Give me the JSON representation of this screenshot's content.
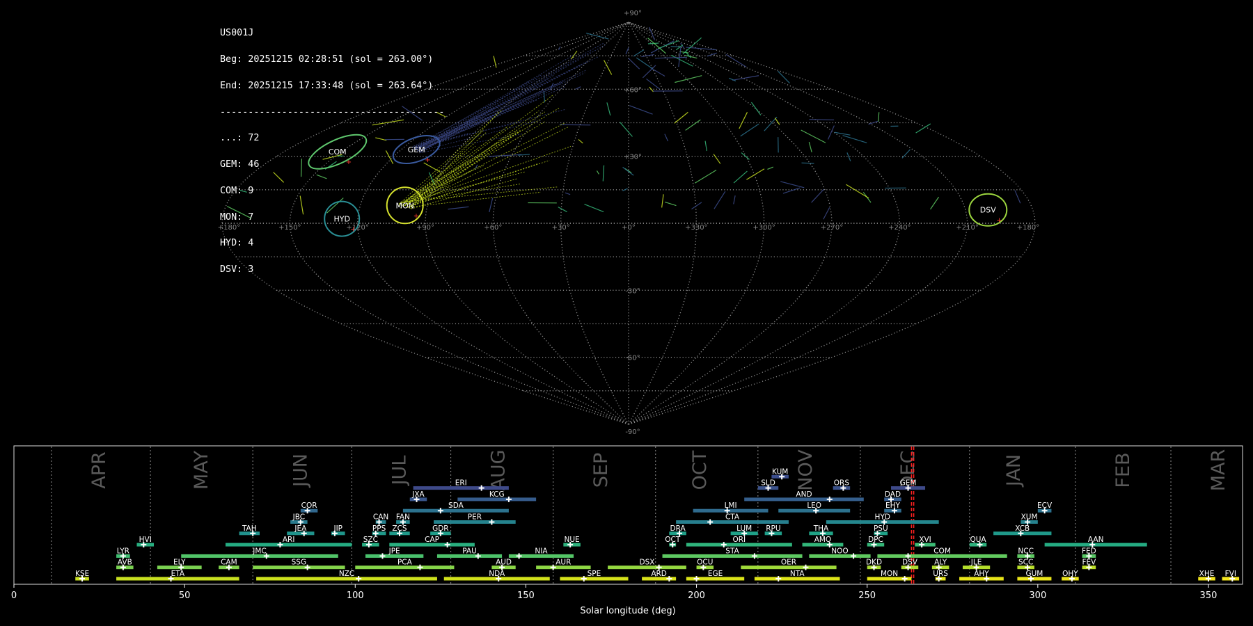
{
  "stats": {
    "station": "US001J",
    "begin": "Beg: 20251215 02:28:51 (sol = 263.00°)",
    "end": "End: 20251215 17:33:48 (sol = 263.64°)",
    "separator": "----------------------------------------",
    "counts": [
      "...: 72",
      "GEM: 46",
      "COM: 9",
      "MON: 7",
      "HYD: 4",
      "DSV: 3"
    ]
  },
  "sky_map": {
    "lon_labels": [
      "+180°",
      "+150°",
      "+120°",
      "+90°",
      "+60°",
      "+30°",
      "+0°",
      "+330°",
      "+300°",
      "+270°",
      "+240°",
      "+210°",
      "+180°"
    ],
    "lon_values": [
      180,
      150,
      120,
      90,
      60,
      30,
      0,
      330,
      300,
      270,
      240,
      210,
      180
    ],
    "lat_labels": [
      "+90°",
      "+60°",
      "+30°",
      "-30°",
      "-60°",
      "-90°"
    ],
    "lat_values": [
      90,
      60,
      30,
      -30,
      -60,
      -90
    ],
    "radiant_colors": {
      "COM": "#5fc86e",
      "GEM": "#3a5ba0",
      "MON": "#d6e22e",
      "HYD": "#2a8f95",
      "DSV": "#9bd43e"
    },
    "radiants": [
      {
        "code": "COM",
        "lon": 152,
        "lat": 32
      },
      {
        "code": "GEM",
        "lon": 112,
        "lat": 33
      },
      {
        "code": "MON",
        "lon": 100,
        "lat": 8
      },
      {
        "code": "HYD",
        "lon": 127,
        "lat": 2
      },
      {
        "code": "DSV",
        "lon": 200,
        "lat": 6
      }
    ]
  },
  "timeline": {
    "xlabel": "Solar longitude (deg)",
    "xticks": [
      0,
      50,
      100,
      150,
      200,
      250,
      300,
      350
    ],
    "months": [
      {
        "name": "APR",
        "sol": 25
      },
      {
        "name": "MAY",
        "sol": 55
      },
      {
        "name": "JUN",
        "sol": 84
      },
      {
        "name": "JUL",
        "sol": 113
      },
      {
        "name": "AUG",
        "sol": 142
      },
      {
        "name": "SEP",
        "sol": 172
      },
      {
        "name": "OCT",
        "sol": 201
      },
      {
        "name": "NOV",
        "sol": 232
      },
      {
        "name": "DEC",
        "sol": 262
      },
      {
        "name": "JAN",
        "sol": 293
      },
      {
        "name": "FEB",
        "sol": 325
      },
      {
        "name": "MAR",
        "sol": 353
      }
    ],
    "month_bounds": [
      11,
      40,
      70,
      99,
      128,
      158,
      188,
      218,
      248,
      280,
      311,
      339
    ],
    "observation_sol": [
      263.0,
      263.64
    ]
  },
  "chart_data": [
    {
      "type": "scatter",
      "title": "",
      "projection": "sinusoidal",
      "xlabel": "",
      "ylabel": "",
      "grid": true,
      "series": [
        {
          "name": "COM",
          "points": [
            {
              "x": 152,
              "y": 32
            }
          ],
          "count": 9
        },
        {
          "name": "GEM",
          "points": [
            {
              "x": 112,
              "y": 33
            }
          ],
          "count": 46
        },
        {
          "name": "MON",
          "points": [
            {
              "x": 100,
              "y": 8
            }
          ],
          "count": 7
        },
        {
          "name": "HYD",
          "points": [
            {
              "x": 127,
              "y": 2
            }
          ],
          "count": 4
        },
        {
          "name": "DSV",
          "points": [
            {
              "x": 200,
              "y": 6
            }
          ],
          "count": 3
        }
      ]
    },
    {
      "type": "bar",
      "title": "",
      "xlabel": "Solar longitude (deg)",
      "xlim": [
        0,
        360
      ],
      "grid": false,
      "showers": [
        {
          "code": "KUM",
          "start": 222,
          "end": 227,
          "peak": 225,
          "row": 8,
          "color": "#3b4d8c"
        },
        {
          "code": "ERI",
          "start": 117,
          "end": 145,
          "peak": 137,
          "row": 7,
          "color": "#3e4a89"
        },
        {
          "code": "SLD",
          "start": 218,
          "end": 224,
          "peak": 221,
          "row": 7,
          "color": "#3b528b"
        },
        {
          "code": "ORS",
          "start": 240,
          "end": 245,
          "peak": 243,
          "row": 7,
          "color": "#3b528b"
        },
        {
          "code": "GEM",
          "start": 257,
          "end": 267,
          "peak": 262,
          "row": 7,
          "color": "#3e4a89"
        },
        {
          "code": "JXA",
          "start": 116,
          "end": 121,
          "peak": 118,
          "row": 6,
          "color": "#39568c"
        },
        {
          "code": "KCG",
          "start": 130,
          "end": 153,
          "peak": 145,
          "row": 6,
          "color": "#365c8d"
        },
        {
          "code": "AND",
          "start": 214,
          "end": 249,
          "peak": 239,
          "row": 6,
          "color": "#355f8d"
        },
        {
          "code": "DAD",
          "start": 255,
          "end": 260,
          "peak": 257,
          "row": 6,
          "color": "#365c8d"
        },
        {
          "code": "COR",
          "start": 84,
          "end": 89,
          "peak": 86,
          "row": 5,
          "color": "#31688e"
        },
        {
          "code": "SDA",
          "start": 114,
          "end": 145,
          "peak": 125,
          "row": 5,
          "color": "#2c728e"
        },
        {
          "code": "LMI",
          "start": 199,
          "end": 221,
          "peak": 209,
          "row": 5,
          "color": "#2f6b8e"
        },
        {
          "code": "LEO",
          "start": 224,
          "end": 245,
          "peak": 235,
          "row": 5,
          "color": "#2c728e"
        },
        {
          "code": "EHY",
          "start": 255,
          "end": 260,
          "peak": 258,
          "row": 5,
          "color": "#2f6b8e"
        },
        {
          "code": "ECV",
          "start": 300,
          "end": 304,
          "peak": 302,
          "row": 5,
          "color": "#2c728e"
        },
        {
          "code": "JBC",
          "start": 81,
          "end": 86,
          "peak": 84,
          "row": 4,
          "color": "#297b8e"
        },
        {
          "code": "CAN",
          "start": 106,
          "end": 109,
          "peak": 107,
          "row": 4,
          "color": "#26818e"
        },
        {
          "code": "FAN",
          "start": 112,
          "end": 116,
          "peak": 114,
          "row": 4,
          "color": "#24868e"
        },
        {
          "code": "PER",
          "start": 123,
          "end": 147,
          "peak": 140,
          "row": 4,
          "color": "#25838e"
        },
        {
          "code": "CTA",
          "start": 194,
          "end": 227,
          "peak": 204,
          "row": 4,
          "color": "#277f8e"
        },
        {
          "code": "HYD",
          "start": 238,
          "end": 271,
          "peak": 255,
          "row": 4,
          "color": "#24878e"
        },
        {
          "code": "XUM",
          "start": 295,
          "end": 300,
          "peak": 297,
          "row": 4,
          "color": "#26828e"
        },
        {
          "code": "TAH",
          "start": 66,
          "end": 72,
          "peak": 70,
          "row": 3,
          "color": "#21918c"
        },
        {
          "code": "JEA",
          "start": 80,
          "end": 88,
          "peak": 85,
          "row": 3,
          "color": "#20938c"
        },
        {
          "code": "JIP",
          "start": 93,
          "end": 97,
          "peak": 94,
          "row": 3,
          "color": "#1f968b"
        },
        {
          "code": "PPS",
          "start": 105,
          "end": 109,
          "peak": 106,
          "row": 3,
          "color": "#1f998a"
        },
        {
          "code": "ZCS",
          "start": 110,
          "end": 116,
          "peak": 113,
          "row": 3,
          "color": "#1f9a8a"
        },
        {
          "code": "GDR",
          "start": 122,
          "end": 128,
          "peak": 125,
          "row": 3,
          "color": "#1f9e89"
        },
        {
          "code": "DRA",
          "start": 192,
          "end": 197,
          "peak": 195,
          "row": 3,
          "color": "#1fa088"
        },
        {
          "code": "LUM",
          "start": 210,
          "end": 218,
          "peak": 214,
          "row": 3,
          "color": "#1fa188"
        },
        {
          "code": "RPU",
          "start": 220,
          "end": 225,
          "peak": 222,
          "row": 3,
          "color": "#1f9e89"
        },
        {
          "code": "THA",
          "start": 233,
          "end": 240,
          "peak": 237,
          "row": 3,
          "color": "#20a386"
        },
        {
          "code": "PSU",
          "start": 252,
          "end": 256,
          "peak": 253,
          "row": 3,
          "color": "#1fa187"
        },
        {
          "code": "XCB",
          "start": 287,
          "end": 304,
          "peak": 295,
          "row": 3,
          "color": "#1f998a"
        },
        {
          "code": "HVI",
          "start": 36,
          "end": 41,
          "peak": 38,
          "row": 2,
          "color": "#28ae80"
        },
        {
          "code": "ARI",
          "start": 62,
          "end": 99,
          "peak": 78,
          "row": 2,
          "color": "#25ab82"
        },
        {
          "code": "SZC",
          "start": 102,
          "end": 107,
          "peak": 104,
          "row": 2,
          "color": "#27ad81"
        },
        {
          "code": "CAP",
          "start": 110,
          "end": 135,
          "peak": 127,
          "row": 2,
          "color": "#29af7f"
        },
        {
          "code": "NUE",
          "start": 161,
          "end": 166,
          "peak": 163,
          "row": 2,
          "color": "#2db27d"
        },
        {
          "code": "OCT",
          "start": 192,
          "end": 194,
          "peak": 193,
          "row": 2,
          "color": "#2eb37c"
        },
        {
          "code": "ORI",
          "start": 197,
          "end": 228,
          "peak": 208,
          "row": 2,
          "color": "#2fb47c"
        },
        {
          "code": "AMO",
          "start": 231,
          "end": 243,
          "peak": 239,
          "row": 2,
          "color": "#32b67a"
        },
        {
          "code": "DPC",
          "start": 250,
          "end": 255,
          "peak": 252,
          "row": 2,
          "color": "#35b779"
        },
        {
          "code": "XVI",
          "start": 264,
          "end": 270,
          "peak": 266,
          "row": 2,
          "color": "#3bbb75"
        },
        {
          "code": "QUA",
          "start": 280,
          "end": 285,
          "peak": 283,
          "row": 2,
          "color": "#2db27d"
        },
        {
          "code": "AAN",
          "start": 302,
          "end": 332,
          "peak": 316,
          "row": 2,
          "color": "#25ab82"
        },
        {
          "code": "LYR",
          "start": 30,
          "end": 34,
          "peak": 32,
          "row": 1,
          "color": "#40bd72"
        },
        {
          "code": "JMC",
          "start": 49,
          "end": 95,
          "peak": 74,
          "row": 1,
          "color": "#52c569"
        },
        {
          "code": "JPE",
          "start": 103,
          "end": 120,
          "peak": 108,
          "row": 1,
          "color": "#4ac16d"
        },
        {
          "code": "PAU",
          "start": 124,
          "end": 143,
          "peak": 136,
          "row": 1,
          "color": "#4ec36b"
        },
        {
          "code": "NIA",
          "start": 145,
          "end": 164,
          "peak": 148,
          "row": 1,
          "color": "#55c667"
        },
        {
          "code": "STA",
          "start": 190,
          "end": 231,
          "peak": 217,
          "row": 1,
          "color": "#5ec962"
        },
        {
          "code": "NOO",
          "start": 233,
          "end": 251,
          "peak": 246,
          "row": 1,
          "color": "#60ca60"
        },
        {
          "code": "COM",
          "start": 253,
          "end": 291,
          "peak": 262,
          "row": 1,
          "color": "#63cb5f"
        },
        {
          "code": "NCC",
          "start": 294,
          "end": 299,
          "peak": 297,
          "row": 1,
          "color": "#5ec962"
        },
        {
          "code": "FED",
          "start": 313,
          "end": 317,
          "peak": 315,
          "row": 1,
          "color": "#58c765"
        },
        {
          "code": "AVB",
          "start": 30,
          "end": 35,
          "peak": 32,
          "row": 0,
          "color": "#7ad151"
        },
        {
          "code": "ELY",
          "start": 42,
          "end": 55,
          "peak": 49,
          "row": 0,
          "color": "#7ad151"
        },
        {
          "code": "CAM",
          "start": 60,
          "end": 66,
          "peak": 63,
          "row": 0,
          "color": "#81d34d"
        },
        {
          "code": "SSG",
          "start": 70,
          "end": 97,
          "peak": 86,
          "row": 0,
          "color": "#84d44b"
        },
        {
          "code": "PCA",
          "start": 100,
          "end": 129,
          "peak": 119,
          "row": 0,
          "color": "#86d549"
        },
        {
          "code": "AUD",
          "start": 140,
          "end": 147,
          "peak": 143,
          "row": 0,
          "color": "#8bd646"
        },
        {
          "code": "AUR",
          "start": 153,
          "end": 169,
          "peak": 158,
          "row": 0,
          "color": "#8fd744"
        },
        {
          "code": "DSX",
          "start": 174,
          "end": 197,
          "peak": 189,
          "row": 0,
          "color": "#95d840"
        },
        {
          "code": "OCU",
          "start": 200,
          "end": 205,
          "peak": 202,
          "row": 0,
          "color": "#99d83d"
        },
        {
          "code": "OER",
          "start": 213,
          "end": 241,
          "peak": 232,
          "row": 0,
          "color": "#a0da39"
        },
        {
          "code": "DKD",
          "start": 250,
          "end": 254,
          "peak": 252,
          "row": 0,
          "color": "#a8db34"
        },
        {
          "code": "DSV",
          "start": 260,
          "end": 265,
          "peak": 262,
          "row": 0,
          "color": "#addc30"
        },
        {
          "code": "ALY",
          "start": 269,
          "end": 274,
          "peak": 271,
          "row": 0,
          "color": "#b2dd2d"
        },
        {
          "code": "JLE",
          "start": 278,
          "end": 286,
          "peak": 282,
          "row": 0,
          "color": "#b5de2b"
        },
        {
          "code": "SCC",
          "start": 294,
          "end": 299,
          "peak": 297,
          "row": 0,
          "color": "#b8de29"
        },
        {
          "code": "FEV",
          "start": 313,
          "end": 317,
          "peak": 315,
          "row": 0,
          "color": "#bddf26"
        },
        {
          "code": "KSE",
          "start": 18,
          "end": 22,
          "peak": 20,
          "row": -1,
          "color": "#c8e020"
        },
        {
          "code": "ETA",
          "start": 30,
          "end": 66,
          "peak": 46,
          "row": -1,
          "color": "#c8e020"
        },
        {
          "code": "NZC",
          "start": 71,
          "end": 124,
          "peak": 101,
          "row": -1,
          "color": "#cde11d"
        },
        {
          "code": "NDA",
          "start": 126,
          "end": 157,
          "peak": 142,
          "row": -1,
          "color": "#d2e21b"
        },
        {
          "code": "SPE",
          "start": 160,
          "end": 180,
          "peak": 167,
          "row": -1,
          "color": "#d5e21a"
        },
        {
          "code": "ARD",
          "start": 184,
          "end": 194,
          "peak": 192,
          "row": -1,
          "color": "#d8e219"
        },
        {
          "code": "EGE",
          "start": 197,
          "end": 214,
          "peak": 200,
          "row": -1,
          "color": "#dae319"
        },
        {
          "code": "NTA",
          "start": 217,
          "end": 242,
          "peak": 224,
          "row": -1,
          "color": "#dde318"
        },
        {
          "code": "MON",
          "start": 250,
          "end": 263,
          "peak": 261,
          "row": -1,
          "color": "#e2e418"
        },
        {
          "code": "URS",
          "start": 270,
          "end": 273,
          "peak": 271,
          "row": -1,
          "color": "#e5e419"
        },
        {
          "code": "AHY",
          "start": 277,
          "end": 290,
          "peak": 285,
          "row": -1,
          "color": "#e7e419"
        },
        {
          "code": "GUM",
          "start": 294,
          "end": 304,
          "peak": 298,
          "row": -1,
          "color": "#eae51a"
        },
        {
          "code": "OHY",
          "start": 307,
          "end": 312,
          "peak": 310,
          "row": -1,
          "color": "#ece51b"
        },
        {
          "code": "XHE",
          "start": 347,
          "end": 352,
          "peak": 350,
          "row": -1,
          "color": "#f1e51d"
        },
        {
          "code": "FVI",
          "start": 354,
          "end": 359,
          "peak": 357,
          "row": -1,
          "color": "#f4e61e"
        }
      ]
    }
  ]
}
